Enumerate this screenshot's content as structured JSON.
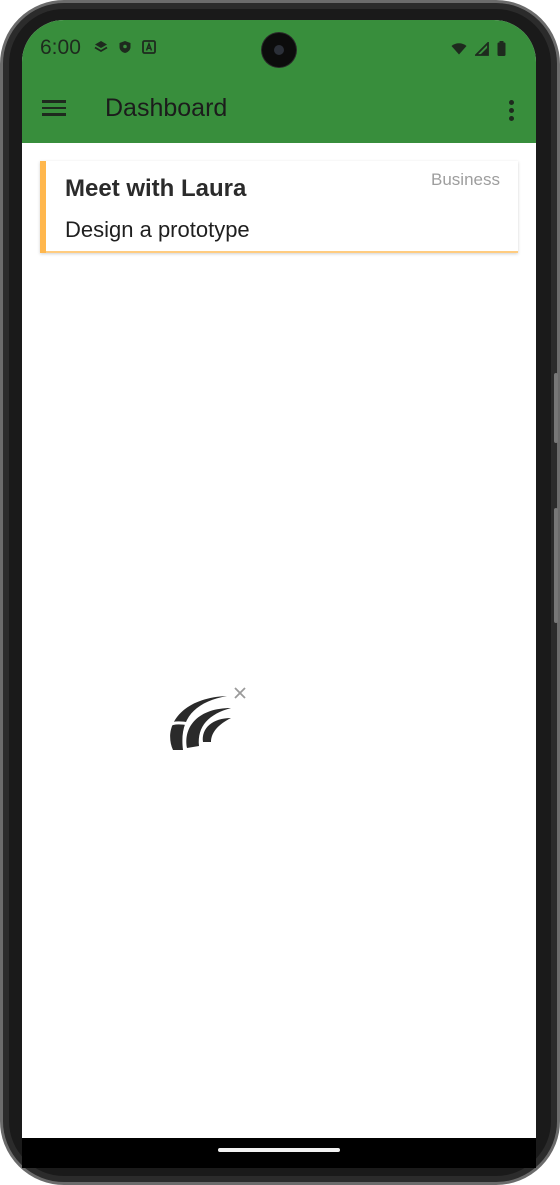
{
  "status_bar": {
    "time": "6:00",
    "left_icons": [
      "layers-icon",
      "shield-icon",
      "a-badge-icon"
    ],
    "right_icons": [
      "wifi-icon",
      "signal-icon",
      "battery-icon"
    ]
  },
  "toolbar": {
    "title": "Dashboard",
    "menu_icon": "hamburger-menu-icon",
    "overflow_icon": "more-vertical-icon"
  },
  "colors": {
    "app_bar": "#388e3c",
    "card_accent": "#ffb74d",
    "category_text": "#9e9e9e"
  },
  "tasks": [
    {
      "title": "Meet with Laura",
      "description": "Design a prototype",
      "category": "Business"
    }
  ],
  "floating_widget": {
    "icon": "swoosh-logo-icon",
    "close_icon": "close-icon"
  }
}
